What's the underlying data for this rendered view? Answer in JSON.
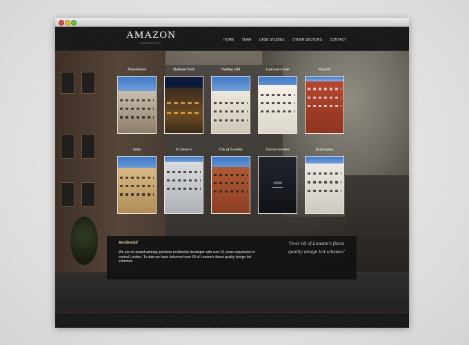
{
  "window": {
    "controls": [
      "close",
      "minimize",
      "zoom"
    ]
  },
  "header": {
    "logo": "AMAZON",
    "logo_sub": "PROPERTY",
    "nav": [
      "HOME",
      "TEAM",
      "CASE STUDIES",
      "OTHER SECTORS",
      "CONTACT"
    ]
  },
  "tiles": [
    {
      "label": "Marylebone"
    },
    {
      "label": "Holland Park"
    },
    {
      "label": "Notting Hill"
    },
    {
      "label": "Lancaster Gate"
    },
    {
      "label": "Mayfair"
    },
    {
      "label": "Soho"
    },
    {
      "label": "St James's"
    },
    {
      "label": "City of London"
    },
    {
      "label": "Covent Garden",
      "overlay_text": "view"
    },
    {
      "label": "Kensington"
    }
  ],
  "info": {
    "title": "Residential",
    "text": "We are an award winning premiere residential developer with over 20 years experience in central London. To date we have delivered over 60 of London's finest quality design led schemes.",
    "quote": "'Over 60 of London's finest quality design led schemes'"
  },
  "colors": {
    "accent": "#e8d9a8",
    "frame": "#e9e4da",
    "header_bg": "#1a1a1a"
  }
}
